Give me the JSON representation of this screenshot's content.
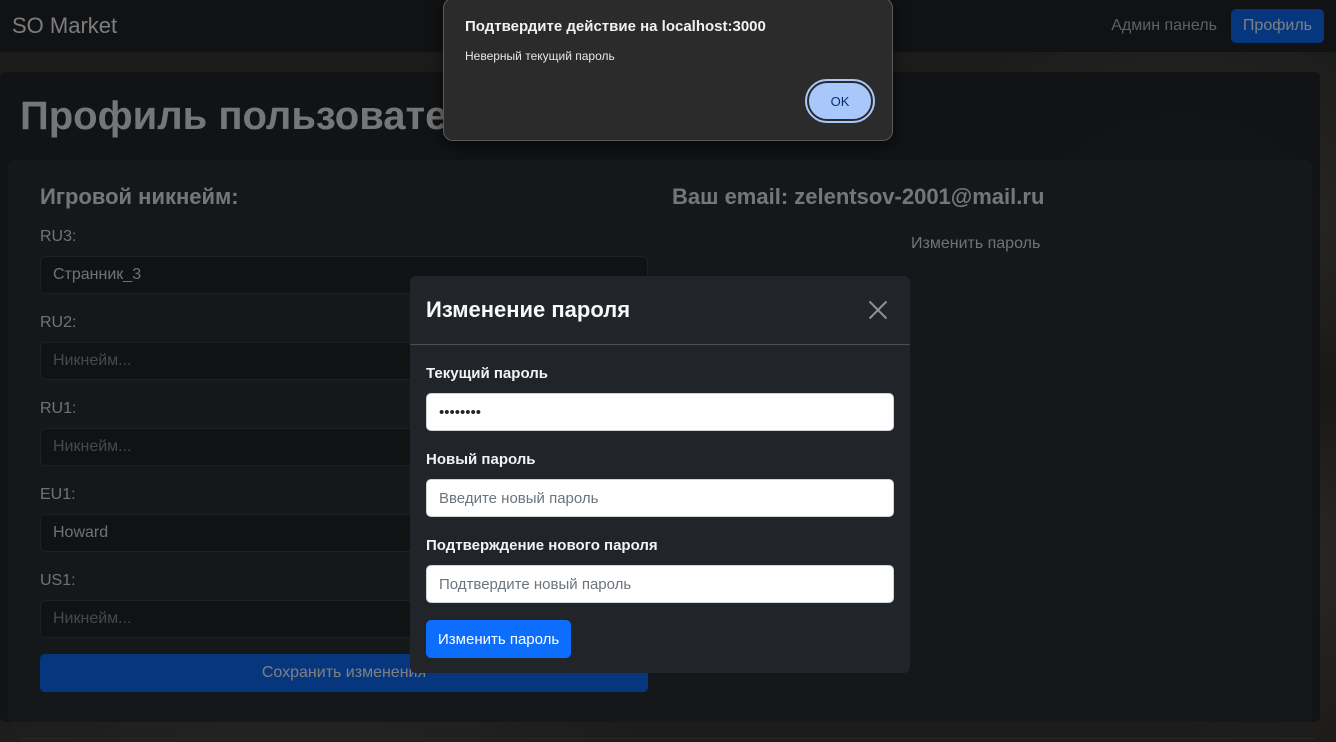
{
  "navbar": {
    "brand": "SO Market",
    "admin_link": "Админ панель",
    "profile_button": "Профиль"
  },
  "page": {
    "title": "Профиль пользователя"
  },
  "profile": {
    "nickname_heading": "Игровой никнейм:",
    "email_heading": "Ваш email: zelentsov-2001@mail.ru",
    "change_password_link": "Изменить пароль",
    "fields": [
      {
        "label": "RU3:",
        "value": "Странник_3",
        "placeholder": "Никнейм..."
      },
      {
        "label": "RU2:",
        "value": "",
        "placeholder": "Никнейм..."
      },
      {
        "label": "RU1:",
        "value": "",
        "placeholder": "Никнейм..."
      },
      {
        "label": "EU1:",
        "value": "Howard",
        "placeholder": "Никнейм..."
      },
      {
        "label": "US1:",
        "value": "",
        "placeholder": "Никнейм..."
      }
    ],
    "save_button": "Сохранить изменения"
  },
  "modal": {
    "title": "Изменение пароля",
    "current_label": "Текущий пароль",
    "current_value": "********",
    "new_label": "Новый пароль",
    "new_placeholder": "Введите новый пароль",
    "confirm_label": "Подтверждение нового пароля",
    "confirm_placeholder": "Подтвердите новый пароль",
    "submit_button": "Изменить пароль"
  },
  "dialog": {
    "title": "Подтвердите действие на localhost:3000",
    "message": "Неверный текущий пароль",
    "ok_button": "OK"
  },
  "colors": {
    "accent": "#0d6efd",
    "navbar_bg": "#212529",
    "dialog_button": "#a8c7fa"
  }
}
